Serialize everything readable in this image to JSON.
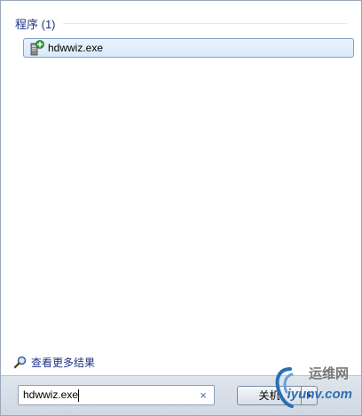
{
  "results": {
    "group_title": "程序 (1)",
    "items": [
      {
        "label": "hdwwiz.exe",
        "icon": "hardware-wizard-icon"
      }
    ]
  },
  "more_results": {
    "label": "查看更多结果",
    "icon": "magnifier-icon"
  },
  "search": {
    "value": "hdwwiz.exe",
    "clear_glyph": "×"
  },
  "shutdown": {
    "label": "关机",
    "arrow_icon": "triangle-right-icon"
  },
  "watermark": {
    "line1": "运维网",
    "line2": "iyunv.com"
  },
  "colors": {
    "group_title": "#1e3287",
    "selection_border": "#7da2ce",
    "bottom_bar": "#dfe5ed"
  }
}
